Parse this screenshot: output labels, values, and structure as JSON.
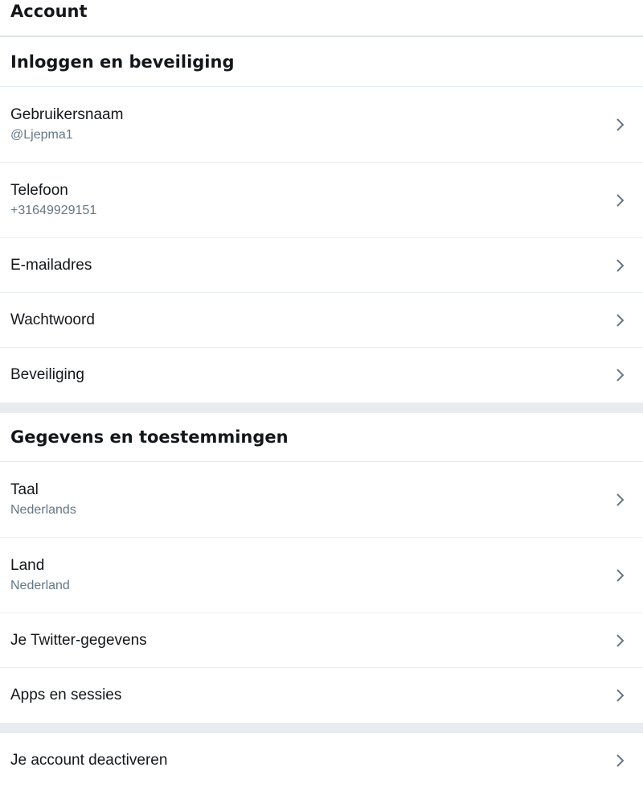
{
  "header": {
    "title": "Account"
  },
  "sections": [
    {
      "title": "Inloggen en beveiliging",
      "items": [
        {
          "label": "Gebruikersnaam",
          "value": "@Ljepma1"
        },
        {
          "label": "Telefoon",
          "value": "+31649929151"
        },
        {
          "label": "E-mailadres"
        },
        {
          "label": "Wachtwoord"
        },
        {
          "label": "Beveiliging"
        }
      ]
    },
    {
      "title": "Gegevens en toestemmingen",
      "items": [
        {
          "label": "Taal",
          "value": "Nederlands"
        },
        {
          "label": "Land",
          "value": "Nederland"
        },
        {
          "label": "Je Twitter-gegevens"
        },
        {
          "label": "Apps en sessies"
        }
      ]
    },
    {
      "items": [
        {
          "label": "Je account deactiveren"
        }
      ]
    }
  ],
  "icons": {
    "row_chevron": "chevron-right-icon"
  },
  "colors": {
    "primary_text": "#14171a",
    "secondary_text": "#657786",
    "divider": "#e6ecf0"
  }
}
